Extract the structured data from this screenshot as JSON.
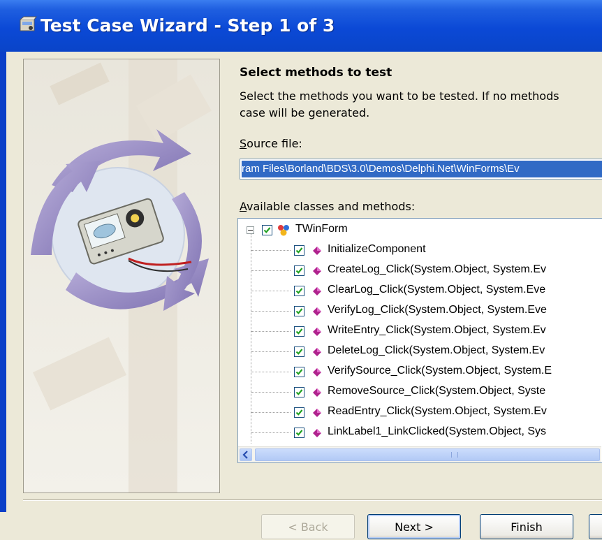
{
  "window": {
    "title": "Test Case Wizard - Step 1 of 3"
  },
  "header": {
    "heading": "Select methods to test",
    "description": "Select the methods you want to be tested.  If no methods\ncase will be generated."
  },
  "source": {
    "label_prefix": "S",
    "label_rest": "ource file:",
    "value": "ram Files\\Borland\\BDS\\3.0\\Demos\\Delphi.Net\\WinForms\\Ev"
  },
  "methods": {
    "label_prefix": "A",
    "label_rest": "vailable classes and methods:",
    "root": {
      "label": "TWinForm",
      "checked": true,
      "expander": "−"
    },
    "items": [
      {
        "label": "InitializeComponent",
        "checked": true
      },
      {
        "label": "CreateLog_Click(System.Object, System.Ev",
        "checked": true
      },
      {
        "label": "ClearLog_Click(System.Object, System.Eve",
        "checked": true
      },
      {
        "label": "VerifyLog_Click(System.Object, System.Eve",
        "checked": true
      },
      {
        "label": "WriteEntry_Click(System.Object, System.Ev",
        "checked": true
      },
      {
        "label": "DeleteLog_Click(System.Object, System.Ev",
        "checked": true
      },
      {
        "label": "VerifySource_Click(System.Object, System.E",
        "checked": true
      },
      {
        "label": "RemoveSource_Click(System.Object, Syste",
        "checked": true
      },
      {
        "label": "ReadEntry_Click(System.Object, System.Ev",
        "checked": true
      },
      {
        "label": "LinkLabel1_LinkClicked(System.Object, Sys",
        "checked": true
      }
    ]
  },
  "buttons": {
    "back": "< Back",
    "next": "Next >",
    "finish": "Finish"
  },
  "colors": {
    "title_bar": "#0a44c8",
    "selection": "#316ac5",
    "method_icon": "#b0238e"
  }
}
